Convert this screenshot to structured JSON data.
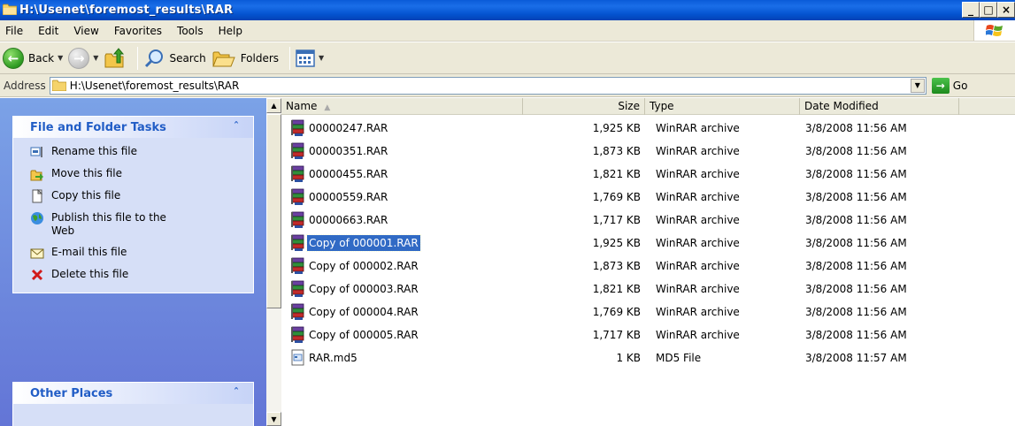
{
  "window": {
    "title": "H:\\Usenet\\foremost_results\\RAR",
    "buttons": {
      "minimize": "_",
      "maximize": "□",
      "close": "×"
    }
  },
  "menu": {
    "items": [
      "File",
      "Edit",
      "View",
      "Favorites",
      "Tools",
      "Help"
    ]
  },
  "toolbar": {
    "back_label": "Back",
    "search_label": "Search",
    "folders_label": "Folders"
  },
  "address": {
    "label": "Address",
    "value": "H:\\Usenet\\foremost_results\\RAR",
    "go_label": "Go"
  },
  "tasks_panel": {
    "title": "File and Folder Tasks",
    "items": [
      {
        "label": "Rename this file",
        "icon": "rename-icon"
      },
      {
        "label": "Move this file",
        "icon": "move-icon"
      },
      {
        "label": "Copy this file",
        "icon": "copy-icon"
      },
      {
        "label": "Publish this file to the Web",
        "icon": "publish-web-icon"
      },
      {
        "label": "E-mail this file",
        "icon": "email-icon"
      },
      {
        "label": "Delete this file",
        "icon": "delete-icon"
      }
    ]
  },
  "other_places_panel": {
    "title": "Other Places"
  },
  "columns": {
    "name": "Name",
    "size": "Size",
    "type": "Type",
    "date": "Date Modified"
  },
  "files": [
    {
      "name": "00000247.RAR",
      "size": "1,925 KB",
      "type": "WinRAR archive",
      "date": "3/8/2008 11:56 AM",
      "icon": "winrar-icon",
      "selected": false
    },
    {
      "name": "00000351.RAR",
      "size": "1,873 KB",
      "type": "WinRAR archive",
      "date": "3/8/2008 11:56 AM",
      "icon": "winrar-icon",
      "selected": false
    },
    {
      "name": "00000455.RAR",
      "size": "1,821 KB",
      "type": "WinRAR archive",
      "date": "3/8/2008 11:56 AM",
      "icon": "winrar-icon",
      "selected": false
    },
    {
      "name": "00000559.RAR",
      "size": "1,769 KB",
      "type": "WinRAR archive",
      "date": "3/8/2008 11:56 AM",
      "icon": "winrar-icon",
      "selected": false
    },
    {
      "name": "00000663.RAR",
      "size": "1,717 KB",
      "type": "WinRAR archive",
      "date": "3/8/2008 11:56 AM",
      "icon": "winrar-icon",
      "selected": false
    },
    {
      "name": "Copy of 000001.RAR",
      "size": "1,925 KB",
      "type": "WinRAR archive",
      "date": "3/8/2008 11:56 AM",
      "icon": "winrar-icon",
      "selected": true
    },
    {
      "name": "Copy of 000002.RAR",
      "size": "1,873 KB",
      "type": "WinRAR archive",
      "date": "3/8/2008 11:56 AM",
      "icon": "winrar-icon",
      "selected": false
    },
    {
      "name": "Copy of 000003.RAR",
      "size": "1,821 KB",
      "type": "WinRAR archive",
      "date": "3/8/2008 11:56 AM",
      "icon": "winrar-icon",
      "selected": false
    },
    {
      "name": "Copy of 000004.RAR",
      "size": "1,769 KB",
      "type": "WinRAR archive",
      "date": "3/8/2008 11:56 AM",
      "icon": "winrar-icon",
      "selected": false
    },
    {
      "name": "Copy of 000005.RAR",
      "size": "1,717 KB",
      "type": "WinRAR archive",
      "date": "3/8/2008 11:56 AM",
      "icon": "winrar-icon",
      "selected": false
    },
    {
      "name": "RAR.md5",
      "size": "1 KB",
      "type": "MD5 File",
      "date": "3/8/2008 11:57 AM",
      "icon": "md5-file-icon",
      "selected": false
    }
  ]
}
